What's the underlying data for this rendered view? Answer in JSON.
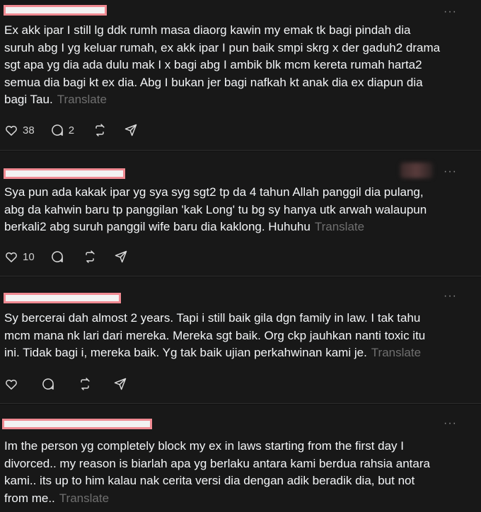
{
  "ui": {
    "more_glyph": "···",
    "translate_label": "Translate"
  },
  "posts": [
    {
      "text": "Ex akk ipar I still lg ddk rumh masa diaorg kawin my emak tk bagi pindah dia\nsuruh abg I yg keluar rumah, ex akk ipar I pun baik smpi skrg x der gaduh2 drama\nsgt apa yg dia ada dulu mak I x bagi abg I ambik blk mcm kereta rumah harta2\nsemua dia bagi kt ex dia. Abg I bukan jer bagi nafkah kt anak dia ex diapun dia\nbagi Tau.",
      "likes": "38",
      "replies": "2"
    },
    {
      "text": "Sya pun ada kakak ipar yg sya syg sgt2 tp da 4 tahun Allah panggil dia pulang,\nabg da kahwin baru tp panggilan 'kak Long' tu bg sy hanya utk arwah walaupun\nberkali2 abg suruh panggil wife baru dia kaklong. Huhuhu",
      "likes": "10"
    },
    {
      "text": "Sy bercerai dah almost 2 years. Tapi i still baik gila dgn family in law. I tak tahu\nmcm mana nk lari dari mereka. Mereka sgt baik. Org ckp jauhkan nanti toxic itu\nini. Tidak bagi i, mereka baik. Yg tak baik ujian perkahwinan kami je."
    },
    {
      "text": "Im the person yg completely block my ex in laws starting from the first day I\ndivorced.. my reason is biarlah apa yg berlaku antara kami berdua rahsia antara\nkami.. its up to him kalau nak cerita versi dia dengan adik beradik dia, but not\nfrom me.."
    }
  ]
}
